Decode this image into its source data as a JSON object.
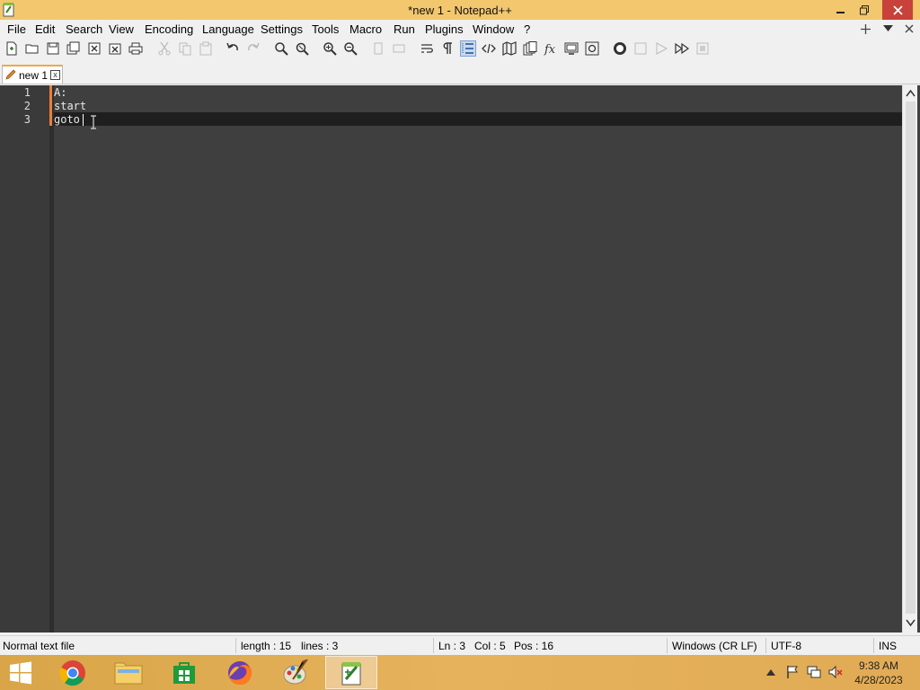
{
  "window": {
    "title": "*new 1 - Notepad++",
    "min_icon": "minimize-icon",
    "max_icon": "restore-icon",
    "close_icon": "close-icon"
  },
  "menubar": {
    "items": [
      "File",
      "Edit",
      "Search",
      "View",
      "Encoding",
      "Language",
      "Settings",
      "Tools",
      "Macro",
      "Run",
      "Plugins",
      "Window",
      "?"
    ],
    "right_icons": [
      "plus-icon",
      "dropdown-arrow-icon",
      "close-icon"
    ]
  },
  "toolbar": {
    "buttons": [
      "new-file-icon",
      "open-file-icon",
      "save-icon",
      "save-all-icon",
      "close-icon",
      "close-all-icon",
      "print-icon",
      "cut-icon",
      "copy-icon",
      "paste-icon",
      "undo-icon",
      "redo-icon",
      "find-icon",
      "replace-icon",
      "zoom-in-icon",
      "zoom-out-icon",
      "sync-vertical-icon",
      "sync-horizontal-icon",
      "word-wrap-icon",
      "show-all-chars-icon",
      "indent-guide-icon",
      "xml-tag-icon",
      "document-map-icon",
      "document-list-icon",
      "function-list-icon",
      "folder-workspace-icon",
      "monitoring-icon",
      "record-macro-icon",
      "stop-recording-icon",
      "play-macro-icon",
      "run-macro-multiple-icon",
      "save-macro-icon"
    ]
  },
  "tabs": [
    {
      "label": "new 1",
      "icon": "pencil-icon",
      "close_label": "x"
    }
  ],
  "editor": {
    "lines": [
      {
        "num": "1",
        "text": "A:"
      },
      {
        "num": "2",
        "text": "start"
      },
      {
        "num": "3",
        "text": "goto"
      }
    ]
  },
  "statusbar": {
    "file_type": "Normal text file",
    "length": "length : 15",
    "lines": "lines : 3",
    "ln": "Ln : 3",
    "col": "Col : 5",
    "pos": "Pos : 16",
    "eol": "Windows (CR LF)",
    "encoding": "UTF-8",
    "mode": "INS"
  },
  "taskbar": {
    "apps": [
      "windows-start-icon",
      "chrome-icon",
      "file-explorer-icon",
      "store-icon",
      "firefox-icon",
      "paint-icon",
      "notepad-plus-plus-icon"
    ],
    "clock_time": "9:38 AM",
    "clock_date": "4/28/2023"
  },
  "colors": {
    "titlebar": "#f2c76e",
    "editor_bg": "#3f3f3f",
    "change_marker": "#e8803a",
    "taskbar": "#e1ab55"
  }
}
